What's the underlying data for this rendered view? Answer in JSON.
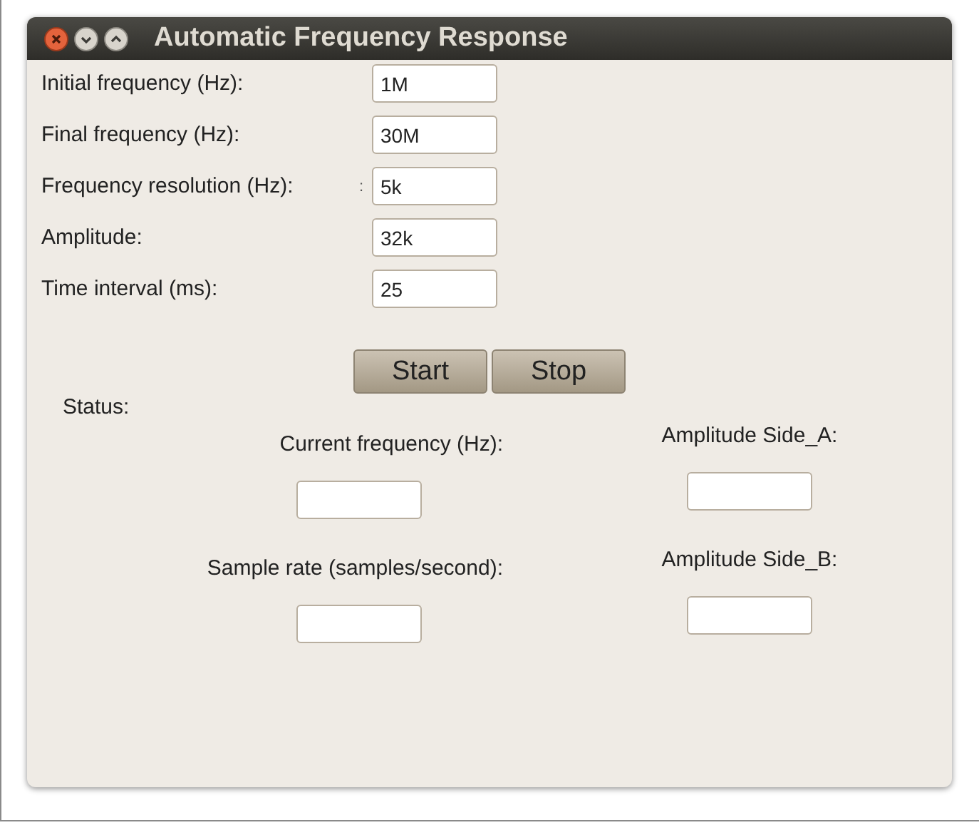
{
  "window": {
    "title": "Automatic Frequency Response"
  },
  "parameters": [
    {
      "label": "Initial frequency (Hz):",
      "value": "1M"
    },
    {
      "label": "Final frequency (Hz):",
      "value": "30M"
    },
    {
      "label": "Frequency resolution (Hz):",
      "suffix": ":",
      "value": "5k"
    },
    {
      "label": "Amplitude:",
      "value": "32k"
    },
    {
      "label": "Time interval (ms):",
      "value": "25"
    }
  ],
  "buttons": [
    "Start",
    "Stop"
  ],
  "status": {
    "label": "Status:",
    "fields": [
      {
        "label": "Current frequency (Hz):"
      },
      {
        "label": "Amplitude Side_A:"
      },
      {
        "label": "Sample rate (samples/second):"
      },
      {
        "label": "Amplitude Side_B:"
      }
    ]
  }
}
